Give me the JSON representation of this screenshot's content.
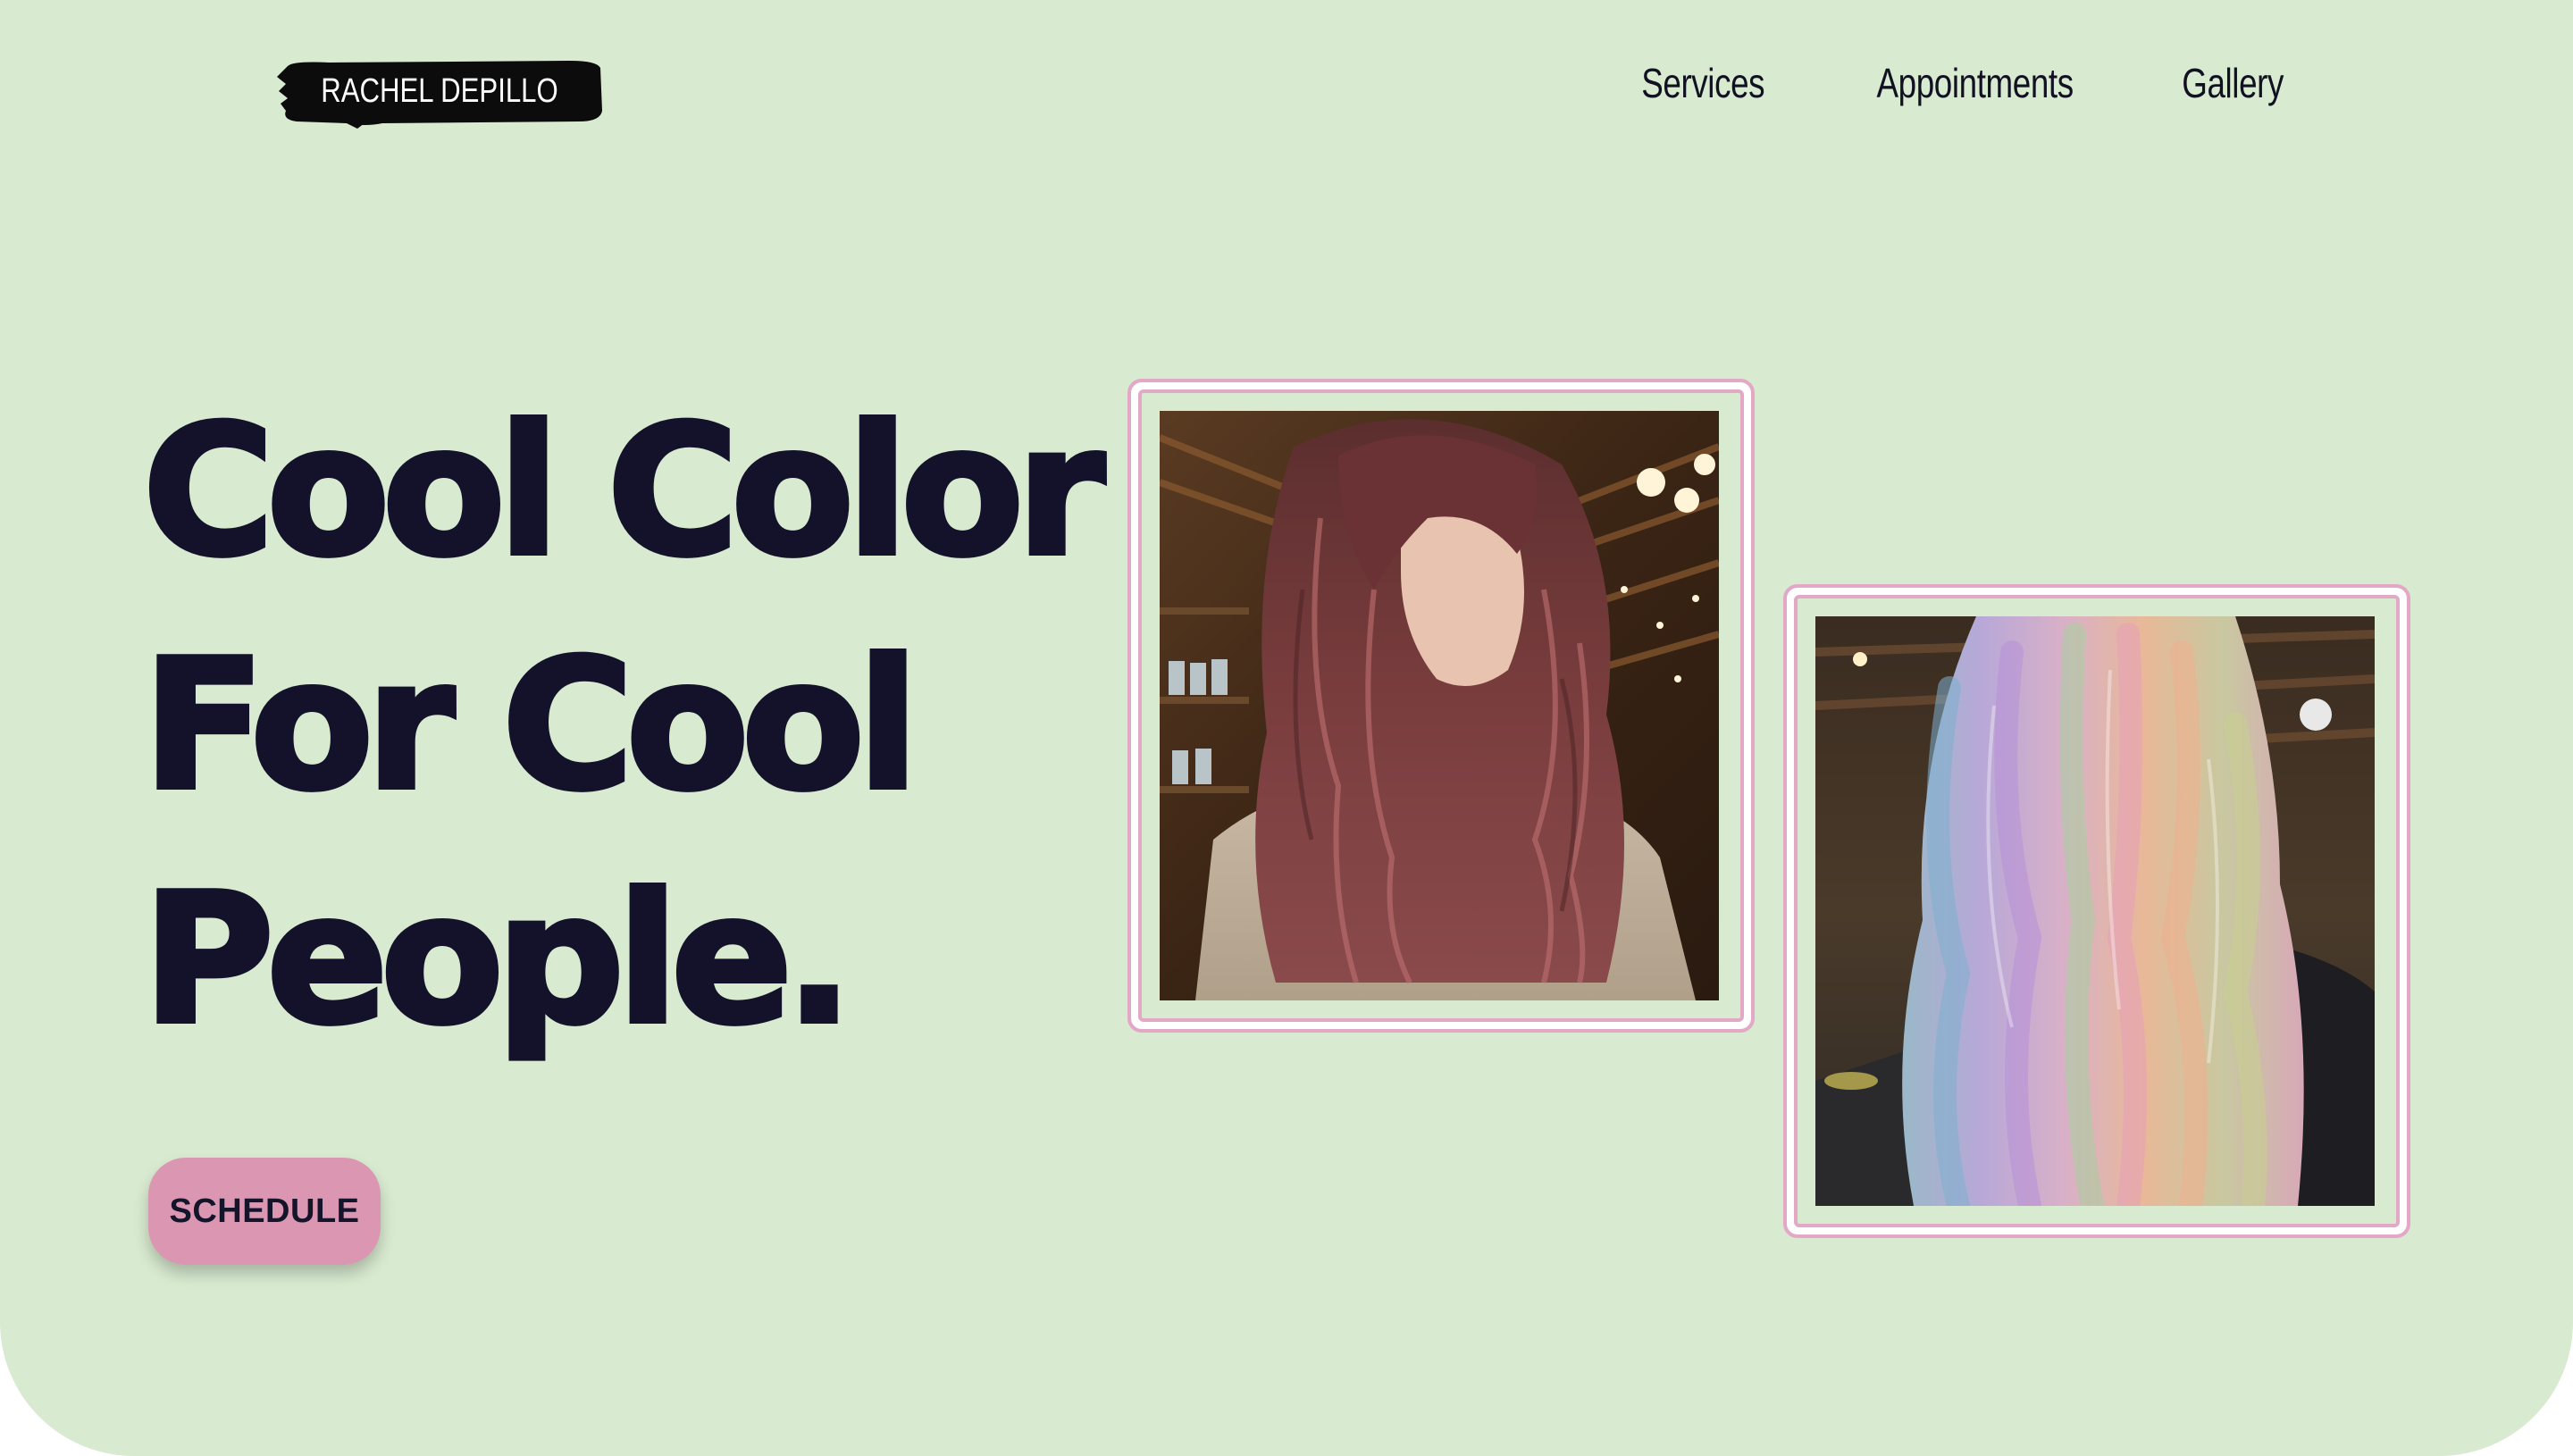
{
  "brand": {
    "name": "RACHEL DEPILLO"
  },
  "nav": {
    "items": [
      "Services",
      "Appointments",
      "Gallery"
    ]
  },
  "hero": {
    "headline_lines": [
      "Cool Color",
      "For Cool",
      "People."
    ],
    "cta_label": "SCHEDULE"
  },
  "gallery": {
    "photos": [
      {
        "subject": "wavy auburn hair with pink highlights"
      },
      {
        "subject": "wavy pastel rainbow hair"
      }
    ]
  },
  "colors": {
    "background": "#d8ead0",
    "text": "#13122a",
    "accent_pink": "#db97b2",
    "frame_border": "#e2a8c6"
  }
}
